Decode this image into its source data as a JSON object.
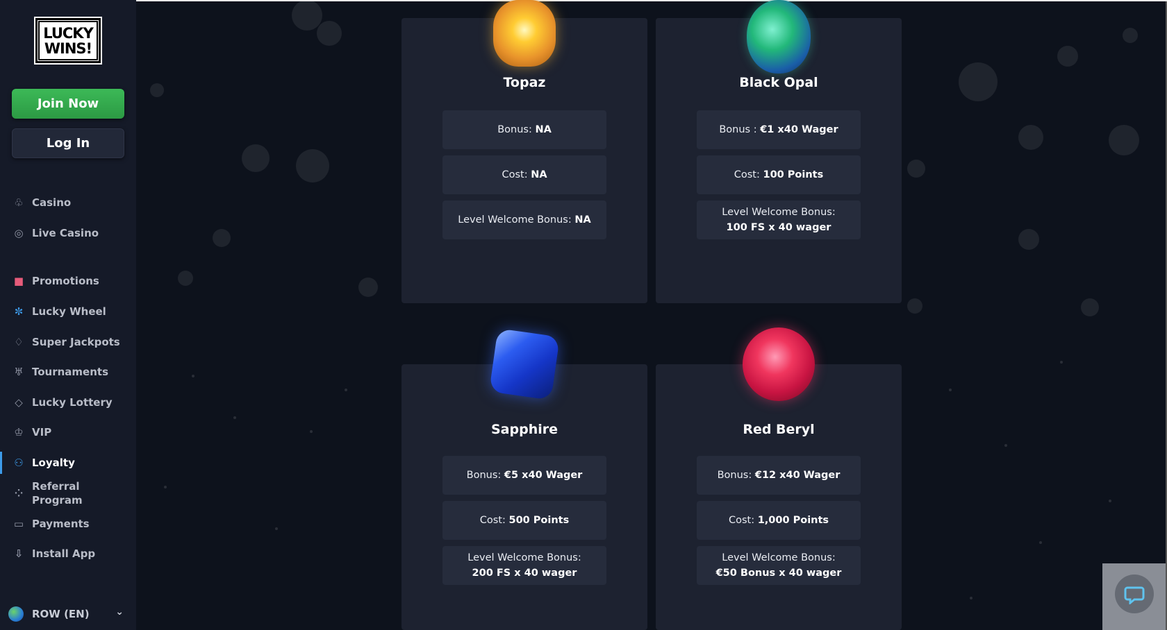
{
  "sidebar": {
    "logo_line1": "LUCKY",
    "logo_line2": "WINS!",
    "join_label": "Join Now",
    "login_label": "Log In",
    "items": [
      {
        "label": "Casino",
        "icon": "casino-icon"
      },
      {
        "label": "Live Casino",
        "icon": "live-casino-icon"
      },
      {
        "label": "Promotions",
        "icon": "gift-icon"
      },
      {
        "label": "Lucky Wheel",
        "icon": "wheel-icon"
      },
      {
        "label": "Super Jackpots",
        "icon": "jackpot-icon"
      },
      {
        "label": "Tournaments",
        "icon": "trophy-icon"
      },
      {
        "label": "Lucky Lottery",
        "icon": "ticket-icon"
      },
      {
        "label": "VIP",
        "icon": "crown-icon"
      },
      {
        "label": "Loyalty",
        "icon": "loyalty-icon"
      },
      {
        "label_line1": "Referral",
        "label_line2": "Program",
        "icon": "referral-icon"
      },
      {
        "label": "Payments",
        "icon": "card-icon"
      },
      {
        "label": "Install App",
        "icon": "download-icon"
      }
    ],
    "language": "ROW (EN)",
    "active_item": "Loyalty"
  },
  "cards": [
    {
      "name": "Topaz",
      "bonus_label": "Bonus:",
      "bonus_value": "NA",
      "cost_label": "Cost:",
      "cost_value": "NA",
      "welcome_label": "Level Welcome Bonus:",
      "welcome_value": "NA"
    },
    {
      "name": "Black Opal",
      "bonus_label": "Bonus :",
      "bonus_value": "€1 x40 Wager",
      "cost_label": "Cost:",
      "cost_value": "100 Points",
      "welcome_label": "Level Welcome Bonus:",
      "welcome_value": "100 FS x 40 wager"
    },
    {
      "name": "Sapphire",
      "bonus_label": "Bonus:",
      "bonus_value": "€5 x40 Wager",
      "cost_label": "Cost:",
      "cost_value": "500 Points",
      "welcome_label": "Level Welcome Bonus:",
      "welcome_value": "200 FS x 40 wager"
    },
    {
      "name": "Red Beryl",
      "bonus_label": "Bonus:",
      "bonus_value": "€12 x40 Wager",
      "cost_label": "Cost:",
      "cost_value": "1,000 Points",
      "welcome_label": "Level Welcome Bonus:",
      "welcome_value": "€50 Bonus x 40 wager"
    }
  ],
  "colors": {
    "join_green": "#37b04f",
    "active_accent": "#3d9be9",
    "card_bg": "#1d2230",
    "pill_bg": "#262c3c"
  }
}
